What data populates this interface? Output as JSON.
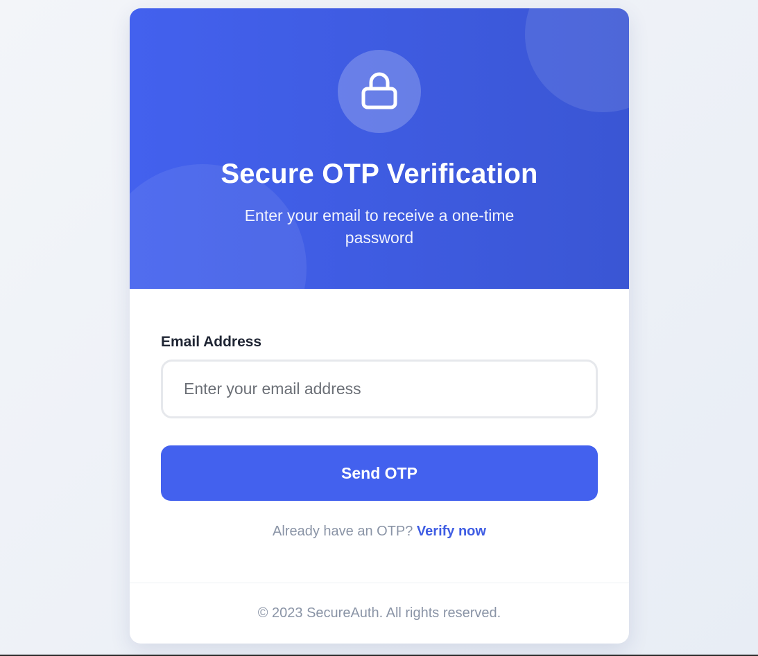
{
  "header": {
    "title": "Secure OTP Verification",
    "subtitle": "Enter your email to receive a one-time password",
    "icon": "lock-icon"
  },
  "form": {
    "email_label": "Email Address",
    "email_placeholder": "Enter your email address",
    "email_value": "",
    "submit_label": "Send OTP"
  },
  "verify": {
    "prompt": "Already have an OTP?",
    "link_label": "Verify now"
  },
  "footer": {
    "copyright": "© 2023 SecureAuth. All rights reserved."
  },
  "colors": {
    "primary": "#4361ee",
    "link": "#3f5de3",
    "muted_text": "#8a94a6",
    "label_text": "#1f2533"
  }
}
